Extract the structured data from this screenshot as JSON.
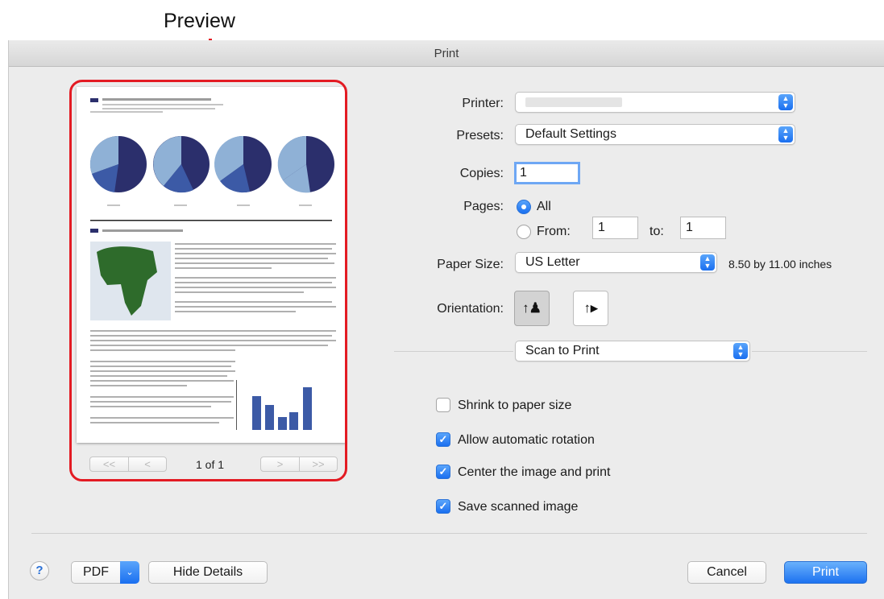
{
  "annotation": {
    "label": "Preview"
  },
  "dialog": {
    "title": "Print"
  },
  "preview": {
    "page_count": "1 of 1",
    "nav_first": "<<",
    "nav_prev": "<",
    "nav_next": ">",
    "nav_last": ">>"
  },
  "printer": {
    "label": "Printer:",
    "value": ""
  },
  "presets": {
    "label": "Presets:",
    "value": "Default Settings"
  },
  "copies": {
    "label": "Copies:",
    "value": "1"
  },
  "pages": {
    "label": "Pages:",
    "all_label": "All",
    "from_label": "From:",
    "from_value": "1",
    "to_label": "to:",
    "to_value": "1",
    "selected": "All"
  },
  "paper_size": {
    "label": "Paper Size:",
    "value": "US Letter",
    "dimensions": "8.50 by 11.00 inches"
  },
  "orientation": {
    "label": "Orientation:",
    "selected": "portrait"
  },
  "section_popup": {
    "value": "Scan to Print"
  },
  "options": [
    {
      "label": "Shrink to paper size",
      "checked": false
    },
    {
      "label": "Allow automatic rotation",
      "checked": true
    },
    {
      "label": "Center the image and print",
      "checked": true
    },
    {
      "label": "Save scanned image",
      "checked": true
    }
  ],
  "footer": {
    "help": "?",
    "pdf": "PDF",
    "hide_details": "Hide Details",
    "cancel": "Cancel",
    "print": "Print"
  },
  "colors": {
    "accent": "#1d72f0",
    "annotation": "#e31b23"
  }
}
